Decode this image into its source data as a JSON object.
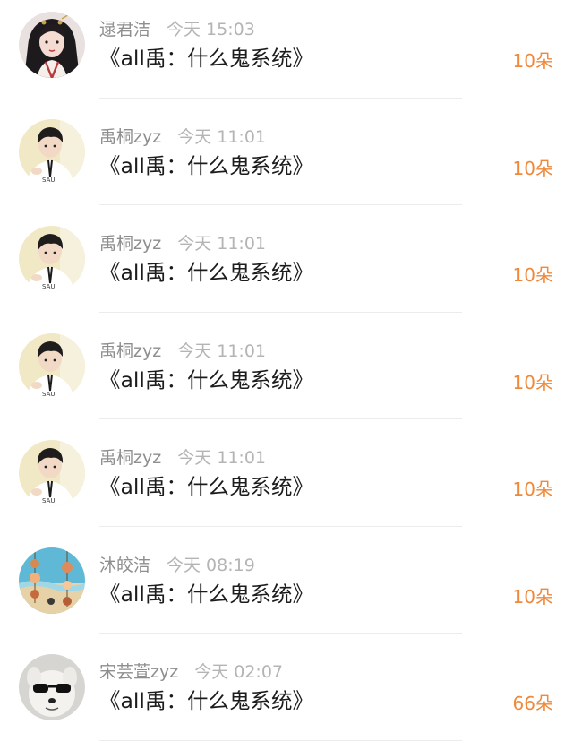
{
  "rows": [
    {
      "name": "逯君洁",
      "time": "今天 15:03",
      "title": "《all禹：什么鬼系统》",
      "amount": "10朵",
      "avatar": "anime-girl-avatar"
    },
    {
      "name": "禹桐zyz",
      "time": "今天 11:01",
      "title": "《all禹：什么鬼系统》",
      "amount": "10朵",
      "avatar": "boy-photo-avatar"
    },
    {
      "name": "禹桐zyz",
      "time": "今天 11:01",
      "title": "《all禹：什么鬼系统》",
      "amount": "10朵",
      "avatar": "boy-photo-avatar"
    },
    {
      "name": "禹桐zyz",
      "time": "今天 11:01",
      "title": "《all禹：什么鬼系统》",
      "amount": "10朵",
      "avatar": "boy-photo-avatar"
    },
    {
      "name": "禹桐zyz",
      "time": "今天 11:01",
      "title": "《all禹：什么鬼系统》",
      "amount": "10朵",
      "avatar": "boy-photo-avatar"
    },
    {
      "name": "沐皎洁",
      "time": "今天 08:19",
      "title": "《all禹：什么鬼系统》",
      "amount": "10朵",
      "avatar": "seashells-beach-avatar"
    },
    {
      "name": "宋芸萱zyz",
      "time": "今天 02:07",
      "title": "《all禹：什么鬼系统》",
      "amount": "66朵",
      "avatar": "dog-sunglasses-avatar"
    }
  ],
  "colors": {
    "amount": "#f0883a",
    "name": "#8e8e8e",
    "time": "#b4b4b4",
    "title": "#1c1c1c"
  }
}
